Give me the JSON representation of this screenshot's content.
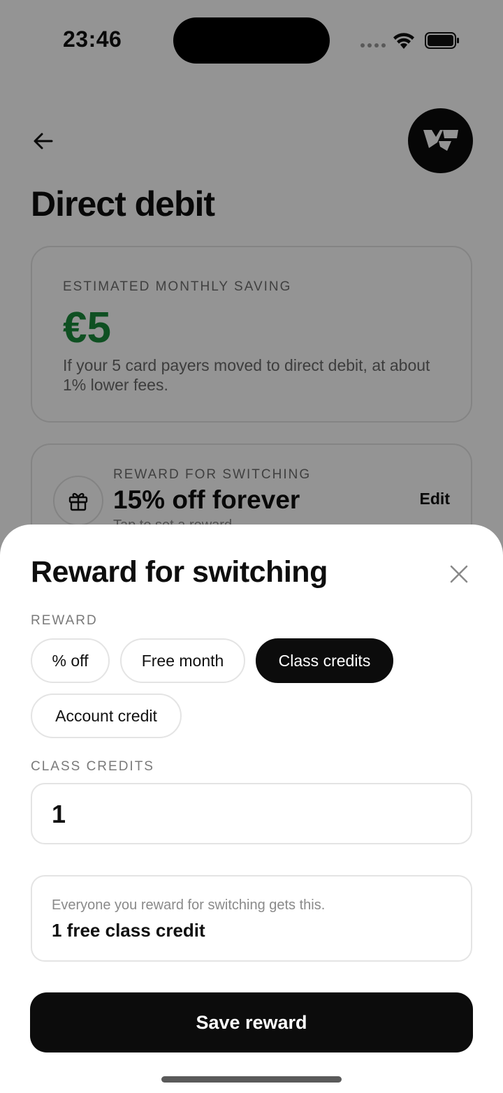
{
  "status_bar": {
    "time": "23:46"
  },
  "header": {
    "title": "Direct debit",
    "back_icon": "arrow-left-icon",
    "logo_icon": "brand-logo-icon"
  },
  "saving_card": {
    "label": "ESTIMATED MONTHLY SAVING",
    "amount": "€5",
    "description": "If your 5 card payers moved to direct debit, at about 1% lower fees.",
    "amount_color": "#1a8a3c"
  },
  "reward_card": {
    "icon": "gift-icon",
    "label": "REWARD FOR SWITCHING",
    "value": "15% off forever",
    "hint": "Tap to set a reward",
    "edit_label": "Edit"
  },
  "sheet": {
    "title": "Reward for switching",
    "close_icon": "close-icon",
    "reward_label": "REWARD",
    "chips": [
      {
        "label": "% off",
        "selected": false
      },
      {
        "label": "Free month",
        "selected": false
      },
      {
        "label": "Class credits",
        "selected": true
      },
      {
        "label": "Account credit",
        "selected": false
      }
    ],
    "credits_label": "CLASS CREDITS",
    "credits_value": "1",
    "summary_note": "Everyone you reward for switching gets this.",
    "summary_value": "1 free class credit",
    "save_label": "Save reward"
  }
}
